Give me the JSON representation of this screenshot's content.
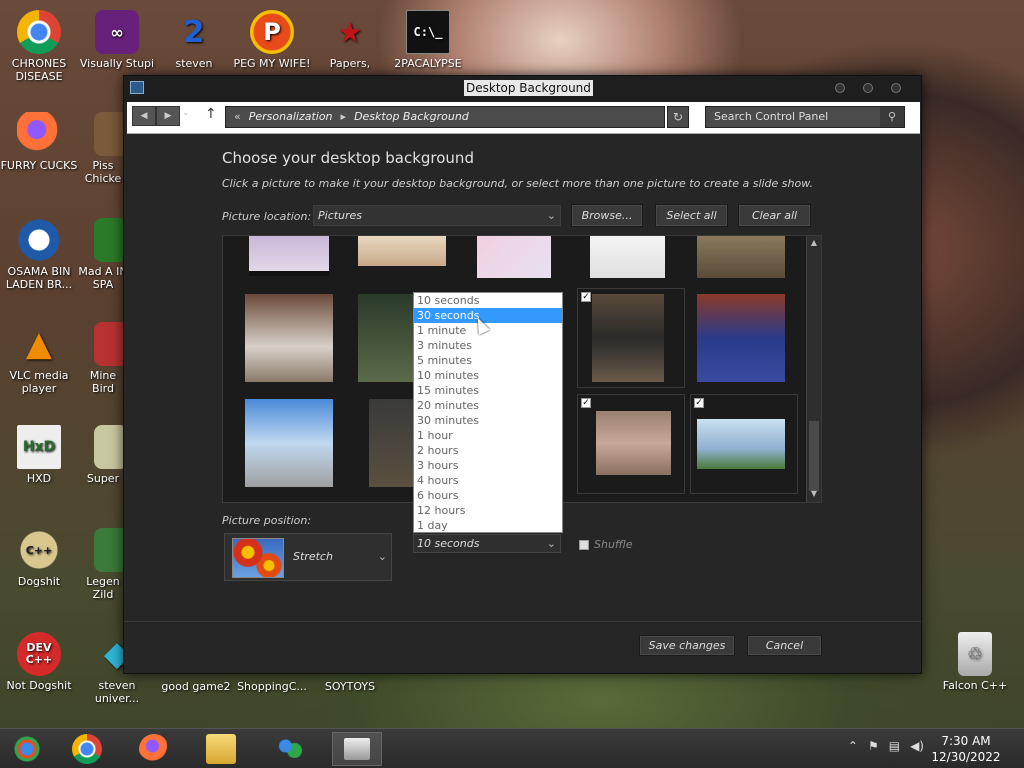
{
  "desktop": {
    "icons": [
      {
        "label": "CHRONES DISEASE",
        "color": "#db4437",
        "glyph": "◉"
      },
      {
        "label": "Visually Stupi",
        "color": "#68217a",
        "glyph": "∞"
      },
      {
        "label": "steven",
        "color": "#c0392b",
        "glyph": "2"
      },
      {
        "label": "PEG MY WIFE!",
        "color": "#e67e22",
        "glyph": "P"
      },
      {
        "label": "Papers,",
        "color": "#8e1b1b",
        "glyph": "★"
      },
      {
        "label": "2PACALYPSE",
        "color": "#111111",
        "glyph": "C:\\_"
      },
      {
        "label": "FURRY CUCKS",
        "color": "#ff7139",
        "glyph": "●"
      },
      {
        "label": "Piss Chicke",
        "color": "#7a5a3a",
        "glyph": "■"
      },
      {
        "label": "OSAMA BIN LADEN BR...",
        "color": "#1e5aa8",
        "glyph": "O"
      },
      {
        "label": "Mad A IN SPA",
        "color": "#2a7a2a",
        "glyph": "■"
      },
      {
        "label": "VLC media player",
        "color": "#f08c00",
        "glyph": "▲"
      },
      {
        "label": "Mine Bird",
        "color": "#b83232",
        "glyph": "■"
      },
      {
        "label": "HXD",
        "color": "#e8e8e8",
        "glyph": "HxD"
      },
      {
        "label": "Super",
        "color": "#c8c8a0",
        "glyph": "■"
      },
      {
        "label": "Dogshit",
        "color": "#d8d0a0",
        "glyph": "C++"
      },
      {
        "label": "Legen Zild",
        "color": "#3a7a3a",
        "glyph": "■"
      },
      {
        "label": "Not Dogshit",
        "color": "#d42a2a",
        "glyph": "DEV C++"
      },
      {
        "label": "steven univer...",
        "color": "#2ab8d8",
        "glyph": "◆"
      },
      {
        "label": "good game2",
        "color": "#555555",
        "glyph": ""
      },
      {
        "label": "ShoppingC...",
        "color": "#555555",
        "glyph": ""
      },
      {
        "label": "SOYTOYS",
        "color": "#555555",
        "glyph": ""
      },
      {
        "label": "Falcon C++",
        "color": "#cccccc",
        "glyph": "♲"
      }
    ]
  },
  "window": {
    "title": "Desktop Background",
    "breadcrumb": [
      "«",
      "Personalization",
      "▸",
      "Desktop Background"
    ],
    "search_placeholder": "Search Control Panel",
    "heading": "Choose your desktop background",
    "subtext": "Click a picture to make it your desktop background, or select more than one picture to create a slide show.",
    "location_label": "Picture location:",
    "location_value": "Pictures",
    "browse_label": "Browse...",
    "select_all_label": "Select all",
    "clear_all_label": "Clear all",
    "position_label": "Picture position:",
    "position_value": "Stretch",
    "interval_value": "10 seconds",
    "shuffle_label": "Shuffle",
    "save_label": "Save changes",
    "cancel_label": "Cancel",
    "interval_options": [
      "10 seconds",
      "30 seconds",
      "1 minute",
      "3 minutes",
      "5 minutes",
      "10 minutes",
      "15 minutes",
      "20 minutes",
      "30 minutes",
      "1 hour",
      "2 hours",
      "3 hours",
      "4 hours",
      "6 hours",
      "12 hours",
      "1 day"
    ],
    "interval_highlighted": "30 seconds"
  },
  "taskbar": {
    "time": "7:30 AM",
    "date": "12/30/2022"
  }
}
